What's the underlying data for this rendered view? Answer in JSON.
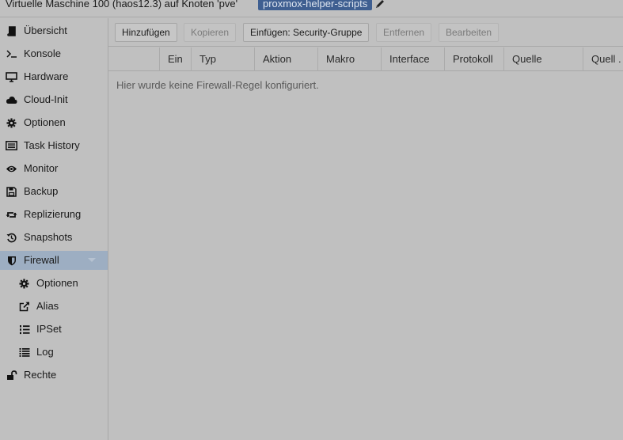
{
  "header": {
    "title": "Virtuelle Maschine 100 (haos12.3) auf Knoten 'pve'",
    "tag": "proxmox-helper-scripts",
    "edit_icon": "pencil-icon"
  },
  "sidebar": {
    "items": [
      {
        "label": "Übersicht",
        "icon": "book-icon"
      },
      {
        "label": "Konsole",
        "icon": "terminal-icon"
      },
      {
        "label": "Hardware",
        "icon": "desktop-icon"
      },
      {
        "label": "Cloud-Init",
        "icon": "cloud-icon"
      },
      {
        "label": "Optionen",
        "icon": "gear-icon"
      },
      {
        "label": "Task History",
        "icon": "list-alt-icon"
      },
      {
        "label": "Monitor",
        "icon": "eye-icon"
      },
      {
        "label": "Backup",
        "icon": "floppy-icon"
      },
      {
        "label": "Replizierung",
        "icon": "retweet-icon"
      },
      {
        "label": "Snapshots",
        "icon": "history-icon"
      },
      {
        "label": "Firewall",
        "icon": "shield-icon",
        "active": true,
        "expanded": true
      },
      {
        "label": "Optionen",
        "icon": "gear-icon",
        "sub": true
      },
      {
        "label": "Alias",
        "icon": "external-link-icon",
        "sub": true
      },
      {
        "label": "IPSet",
        "icon": "list-ol-icon",
        "sub": true
      },
      {
        "label": "Log",
        "icon": "list-icon",
        "sub": true
      },
      {
        "label": "Rechte",
        "icon": "unlock-icon"
      }
    ]
  },
  "toolbar": {
    "add": "Hinzufügen",
    "copy": "Kopieren",
    "insert_group": "Einfügen: Security-Gruppe",
    "remove": "Entfernen",
    "edit": "Bearbeiten"
  },
  "grid": {
    "columns": [
      "",
      "Ein",
      "Typ",
      "Aktion",
      "Makro",
      "Interface",
      "Protokoll",
      "Quelle",
      "Quell ."
    ],
    "empty_text": "Hier wurde keine Firewall-Regel konfiguriert."
  },
  "colors": {
    "background": "#c0c0c0",
    "active_item": "#9daec2",
    "tag_background": "#3f5f91"
  }
}
